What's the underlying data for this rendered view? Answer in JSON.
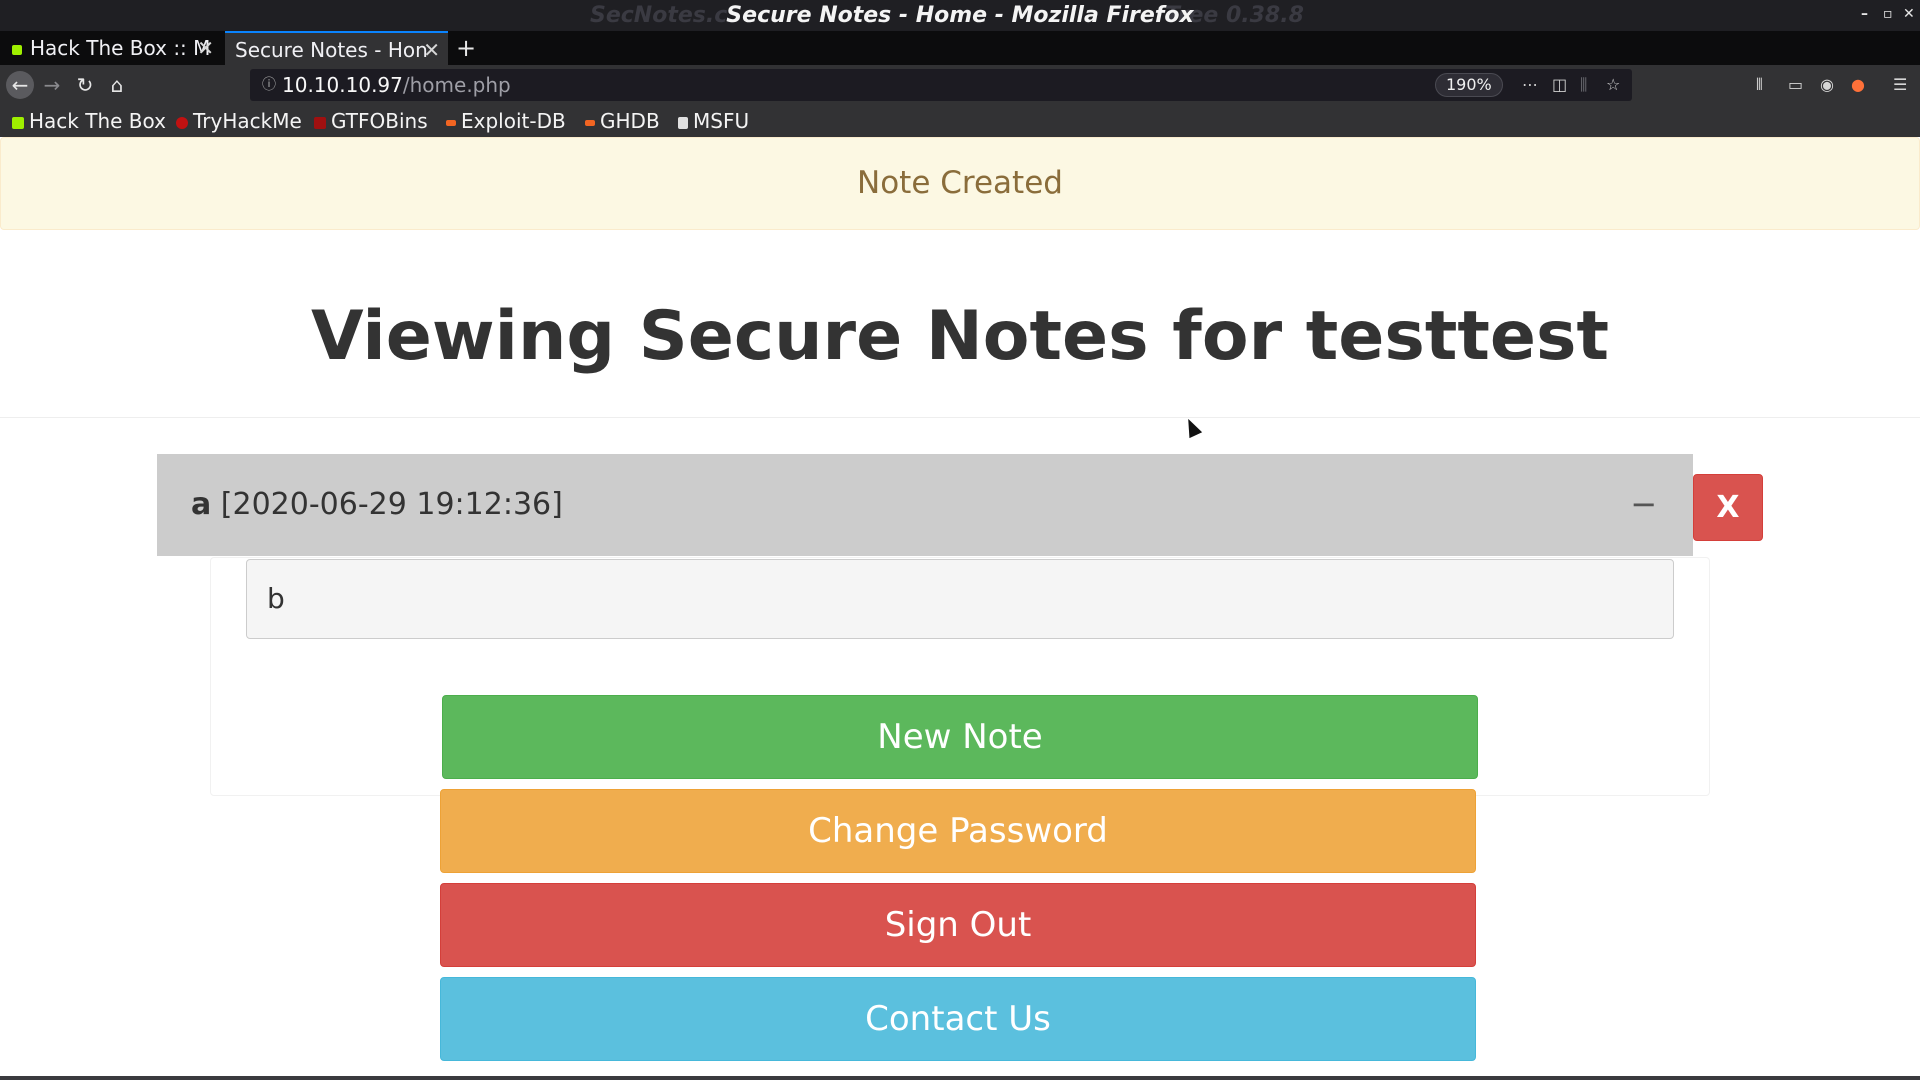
{
  "window": {
    "title": "Secure Notes - Home - Mozilla Firefox",
    "ghost_left": "SecNotes.c",
    "ghost_right": "Tree 0.38.8",
    "controls": [
      "–",
      "▫",
      "✕"
    ]
  },
  "tabs": [
    {
      "label": "Hack The Box :: M",
      "favicon_color": "#9fef00",
      "active": false
    },
    {
      "label": "Secure Notes - Hon",
      "favicon_color": "",
      "active": true
    }
  ],
  "new_tab_label": "+",
  "navbar": {
    "url_host": "10.10.10.97",
    "url_path": "/home.php",
    "zoom": "190%"
  },
  "bookmarks": [
    {
      "label": "Hack The Box",
      "icon_color": "#9fef00"
    },
    {
      "label": "TryHackMe",
      "icon_color": "#c11111"
    },
    {
      "label": "GTFOBins",
      "icon_color": "#a01010"
    },
    {
      "label": "Exploit-DB",
      "icon_color": "#f26522"
    },
    {
      "label": "GHDB",
      "icon_color": "#f26522"
    },
    {
      "label": "MSFU",
      "icon_color": "#e0e0e0"
    }
  ],
  "alert": {
    "text": "Note Created",
    "color": "#8a6d3b"
  },
  "heading": {
    "prefix": "Viewing Secure Notes for ",
    "username": "testtest"
  },
  "note": {
    "title": "a",
    "timestamp": "[2020-06-29 19:12:36]",
    "collapse_symbol": "−",
    "delete_label": "X",
    "body": "b"
  },
  "actions": {
    "new_note": "New Note",
    "change_password": "Change Password",
    "sign_out": "Sign Out",
    "contact_us": "Contact Us"
  },
  "colors": {
    "success": "#5cb85c",
    "warning": "#f0ad4e",
    "danger": "#d9534f",
    "info": "#5bc0de"
  }
}
